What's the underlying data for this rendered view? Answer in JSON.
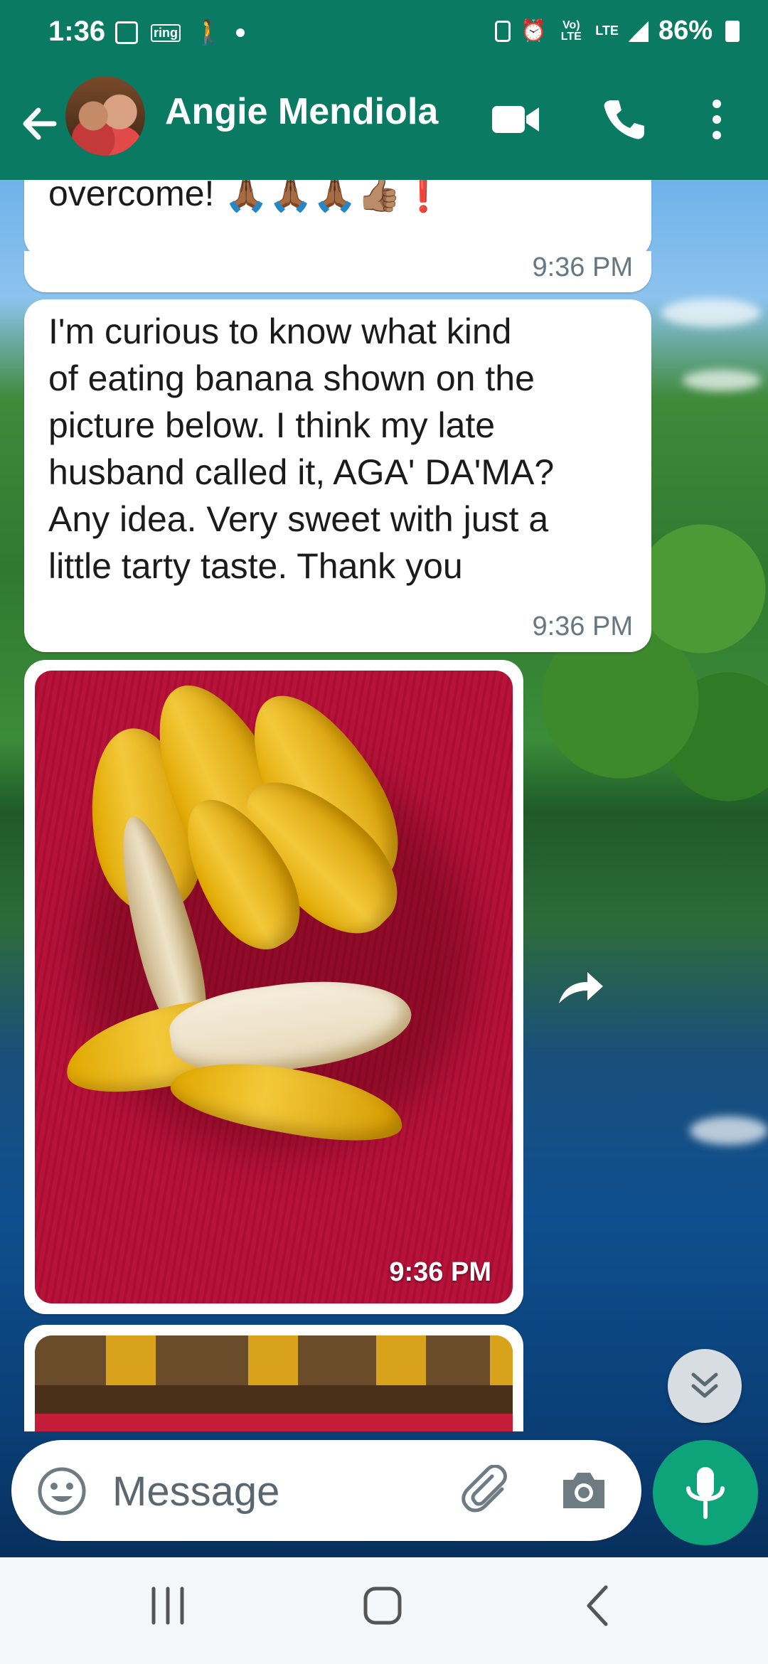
{
  "status_bar": {
    "time": "1:36",
    "ring_label": "ring",
    "network_label": "Vo) LTE",
    "lte_label": "LTE",
    "battery": "86%"
  },
  "app_bar": {
    "contact_name": "Angie Mendiola"
  },
  "messages": [
    {
      "text": "overcome! 🙏🏾🙏🏾🙏🏾👍🏽❗",
      "time": "9:36 PM"
    },
    {
      "text": "I'm curious to know what kind\nof eating banana shown on the\npicture below.  I think my late\nhusband called it, AGA'  DA'MA?\nAny idea.  Very sweet with just a\nlittle tarty taste.  Thank you",
      "time": "9:36 PM"
    },
    {
      "type": "image",
      "time": "9:36 PM"
    }
  ],
  "composer": {
    "placeholder": "Message"
  },
  "colors": {
    "header": "#0a7a62",
    "mic": "#0ea47a"
  },
  "icons": [
    "back-arrow-icon",
    "video-call-icon",
    "phone-icon",
    "more-options-icon",
    "forward-icon",
    "scroll-down-icon",
    "emoji-icon",
    "attach-icon",
    "camera-icon",
    "mic-icon",
    "recents-icon",
    "home-icon",
    "back-nav-icon"
  ]
}
